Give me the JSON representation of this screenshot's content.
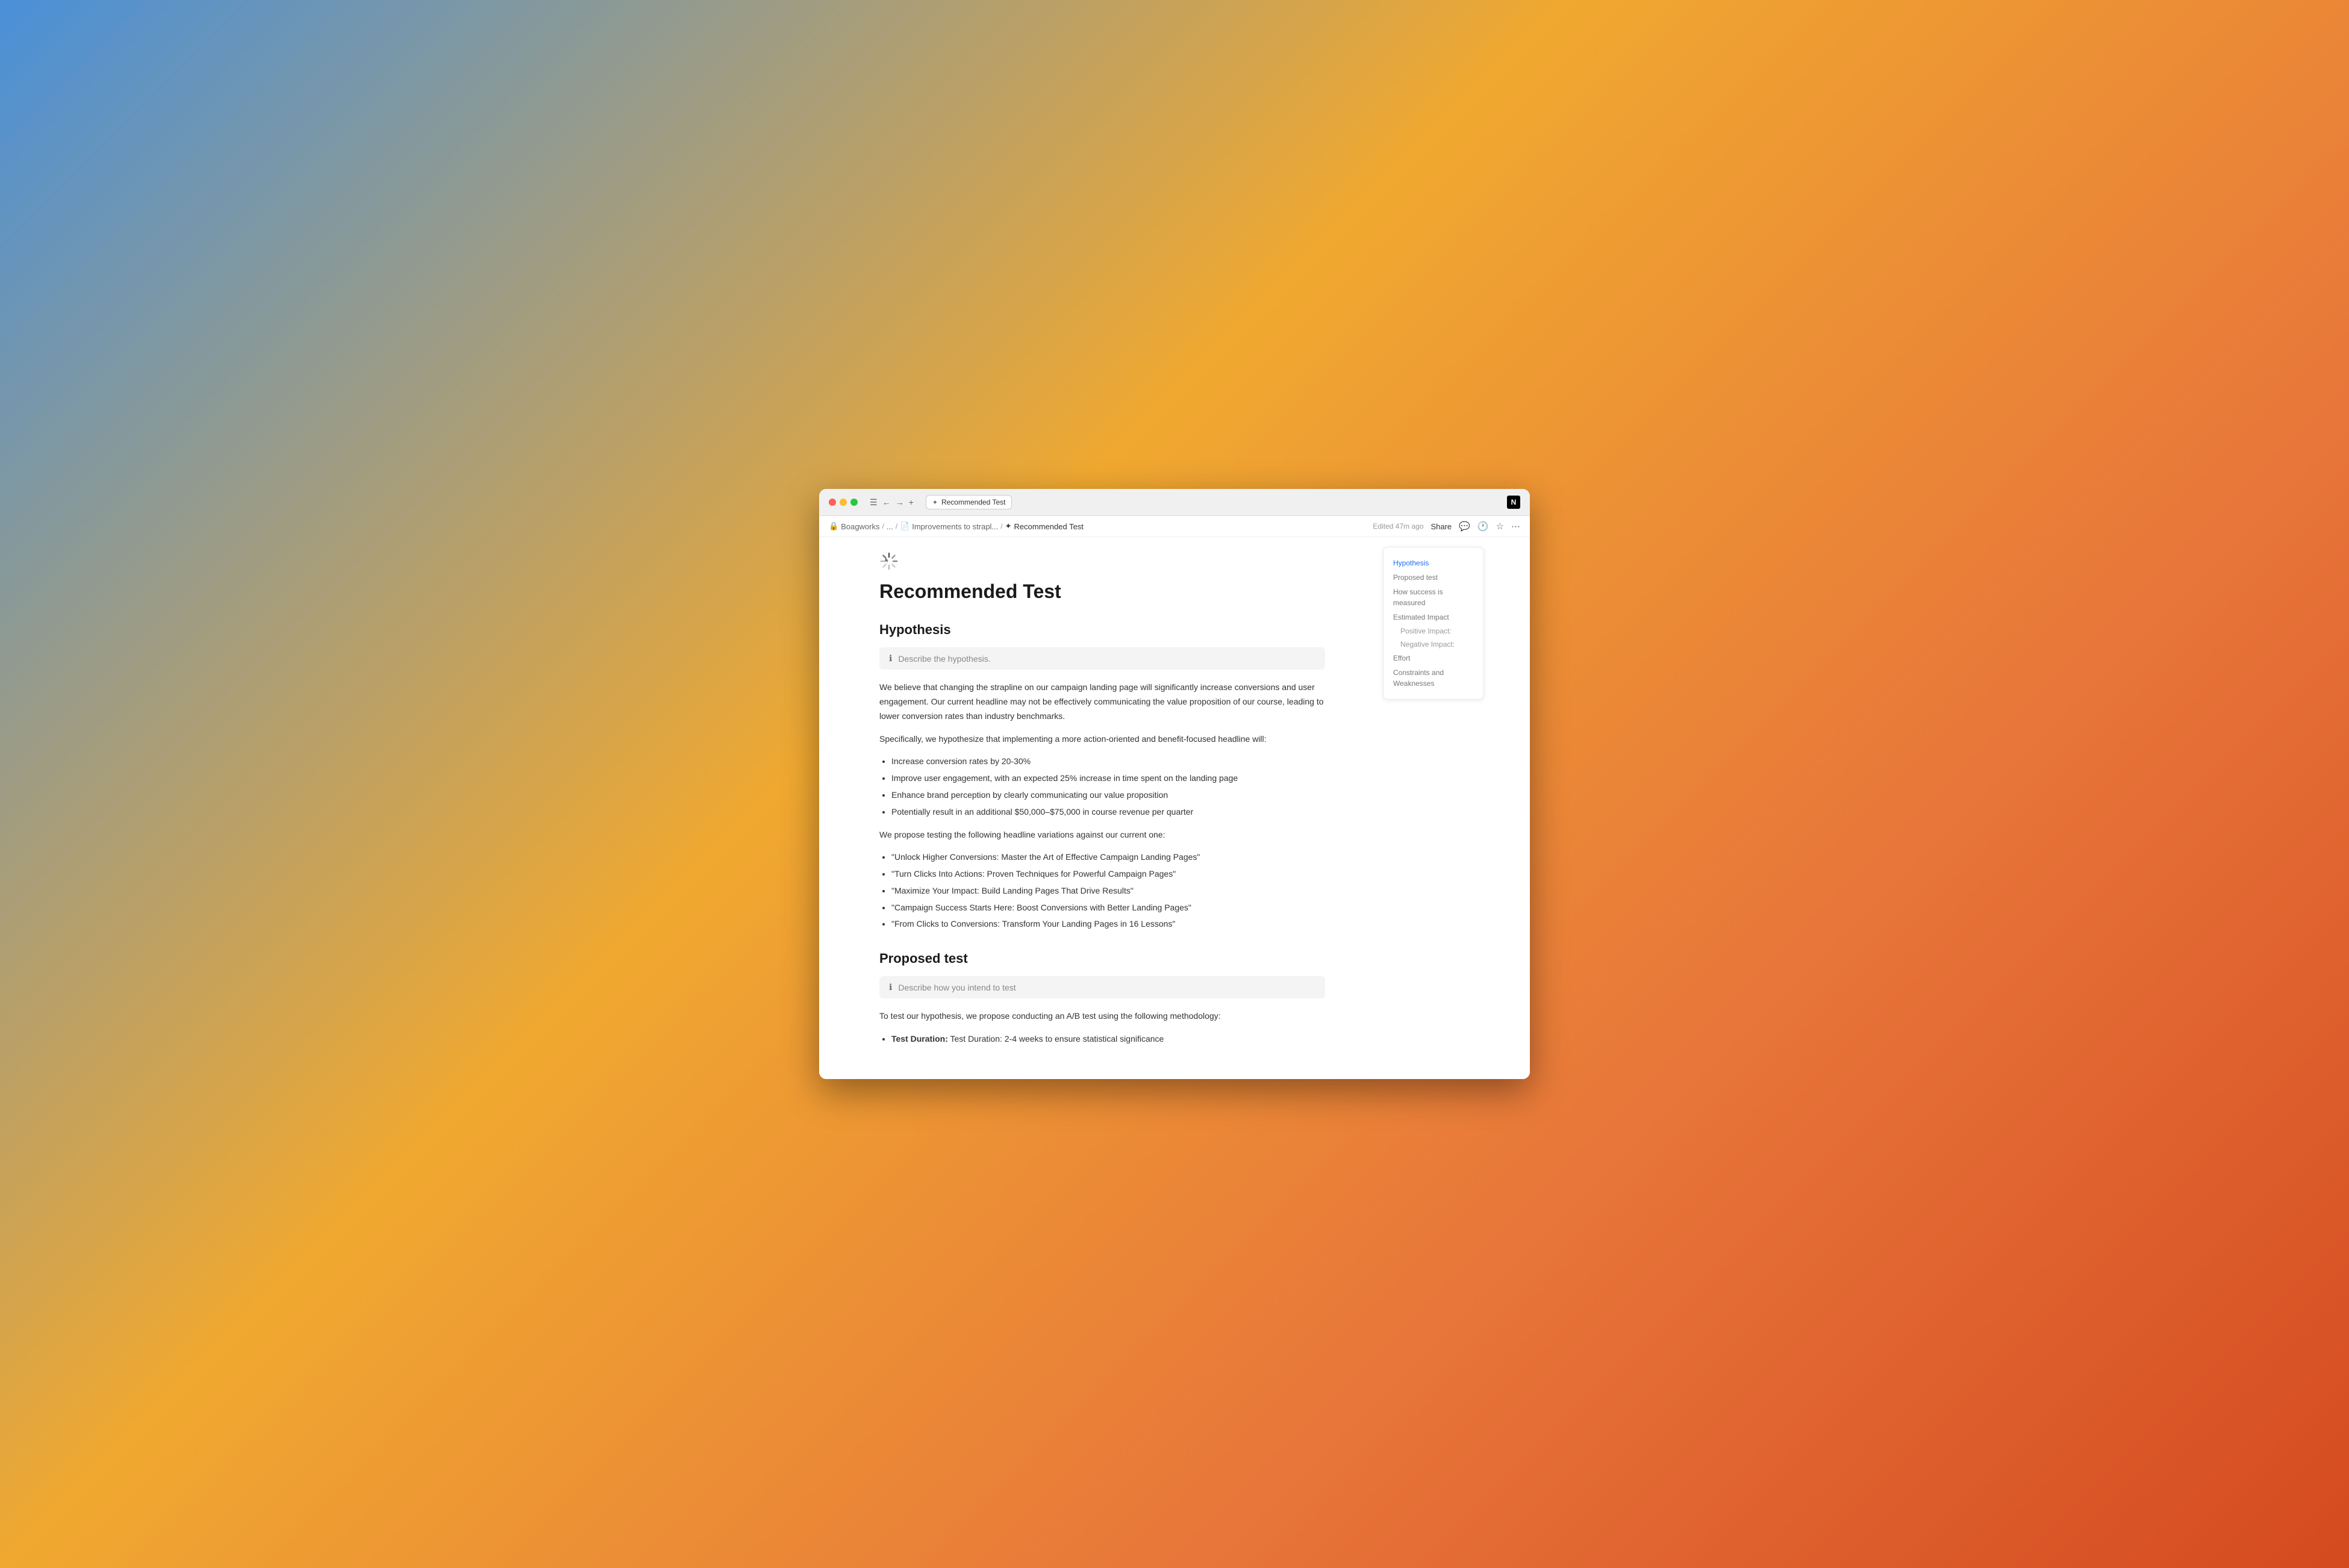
{
  "browser": {
    "tab_title": "Recommended Test",
    "tab_favicon": "✦"
  },
  "breadcrumb": {
    "items": [
      {
        "icon": "🔒",
        "label": "Boagworks"
      },
      {
        "icon": "...",
        "label": "..."
      },
      {
        "icon": "📄",
        "label": "Improvements to strapl..."
      },
      {
        "icon": "✦",
        "label": "Recommended Test"
      }
    ],
    "edited_label": "Edited 47m ago",
    "share_label": "Share"
  },
  "toolbar": {
    "comment_icon": "💬",
    "history_icon": "🕐",
    "star_icon": "☆",
    "more_icon": "⋯"
  },
  "page": {
    "title": "Recommended Test",
    "spinner_alt": "loading spinner"
  },
  "hypothesis": {
    "heading": "Hypothesis",
    "hint": "Describe the hypothesis.",
    "paragraph1": "We believe that changing the strapline on our campaign landing page will significantly increase conversions and user engagement. Our current headline may not be effectively communicating the value proposition of our course, leading to lower conversion rates than industry benchmarks.",
    "paragraph2": "Specifically, we hypothesize that implementing a more action-oriented and benefit-focused headline will:",
    "bullets1": [
      "Increase conversion rates by 20-30%",
      "Improve user engagement, with an expected 25% increase in time spent on the landing page",
      "Enhance brand perception by clearly communicating our value proposition",
      "Potentially result in an additional $50,000–$75,000 in course revenue per quarter"
    ],
    "paragraph3": "We propose testing the following headline variations against our current one:",
    "bullets2": [
      "\"Unlock Higher Conversions: Master the Art of Effective Campaign Landing Pages\"",
      "\"Turn Clicks Into Actions: Proven Techniques for Powerful Campaign Pages\"",
      "\"Maximize Your Impact: Build Landing Pages That Drive Results\"",
      "\"Campaign Success Starts Here: Boost Conversions with Better Landing Pages\"",
      "\"From Clicks to Conversions: Transform Your Landing Pages in 16 Lessons\""
    ]
  },
  "proposed_test": {
    "heading": "Proposed test",
    "hint": "Describe how you intend to test",
    "paragraph1": "To test our hypothesis, we propose conducting an A/B test using the following methodology:",
    "bullet_start": "Test Duration: 2-4 weeks to ensure statistical significance"
  },
  "toc": {
    "items": [
      {
        "label": "Hypothesis",
        "active": true
      },
      {
        "label": "Proposed test",
        "active": false
      },
      {
        "label": "How success is measured",
        "active": false
      },
      {
        "label": "Estimated Impact",
        "active": false
      },
      {
        "label": "Positive Impact:",
        "sub": true,
        "active": false
      },
      {
        "label": "Negative Impact:",
        "sub": true,
        "active": false
      },
      {
        "label": "Effort",
        "active": false
      },
      {
        "label": "Constraints and Weaknesses",
        "active": false
      }
    ]
  }
}
